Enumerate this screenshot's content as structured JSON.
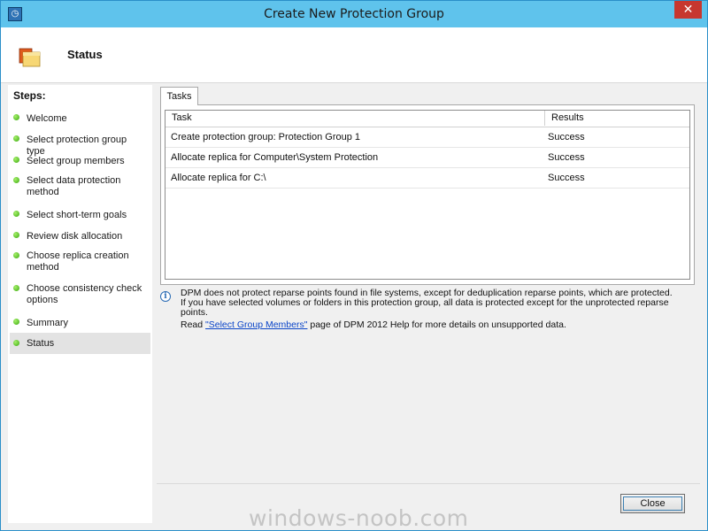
{
  "window": {
    "title": "Create New Protection Group",
    "app_icon": "dpm-clock-icon",
    "close_glyph": "✕"
  },
  "header": {
    "icon": "folder-icon",
    "title": "Status"
  },
  "sidebar": {
    "heading": "Steps:",
    "items": [
      {
        "label": "Welcome"
      },
      {
        "label": "Select protection group type"
      },
      {
        "label": "Select group members"
      },
      {
        "label": "Select data protection method"
      },
      {
        "label": "Select short-term goals"
      },
      {
        "label": "Review disk allocation"
      },
      {
        "label": "Choose replica creation method"
      },
      {
        "label": "Choose consistency check options"
      },
      {
        "label": "Summary"
      },
      {
        "label": "Status"
      }
    ],
    "selected": "Status",
    "status_dot_color": "#3aa90e"
  },
  "tabs": [
    {
      "label": "Tasks"
    }
  ],
  "tasks_table": {
    "columns": [
      "Task",
      "Results"
    ],
    "rows": [
      {
        "task": "Create protection group: Protection Group 1",
        "result": "Success"
      },
      {
        "task": "Allocate replica for Computer\\System Protection",
        "result": "Success"
      },
      {
        "task": "Allocate replica for C:\\",
        "result": "Success"
      }
    ]
  },
  "info": {
    "icon": "info-icon",
    "text": "DPM does not protect reparse points found in file systems, except for deduplication reparse points, which are protected. If you have selected volumes or folders in this protection group, all data is protected except for the unprotected reparse points.",
    "read_prefix": "Read ",
    "link_text": "\"Select Group Members\"",
    "read_suffix": " page of DPM 2012 Help for more details on unsupported data."
  },
  "buttons": {
    "close": "Close"
  },
  "watermark": "windows-noob.com",
  "colors": {
    "titlebar": "#5fc3ec",
    "close_button": "#c7372f",
    "link": "#0a44c8"
  }
}
